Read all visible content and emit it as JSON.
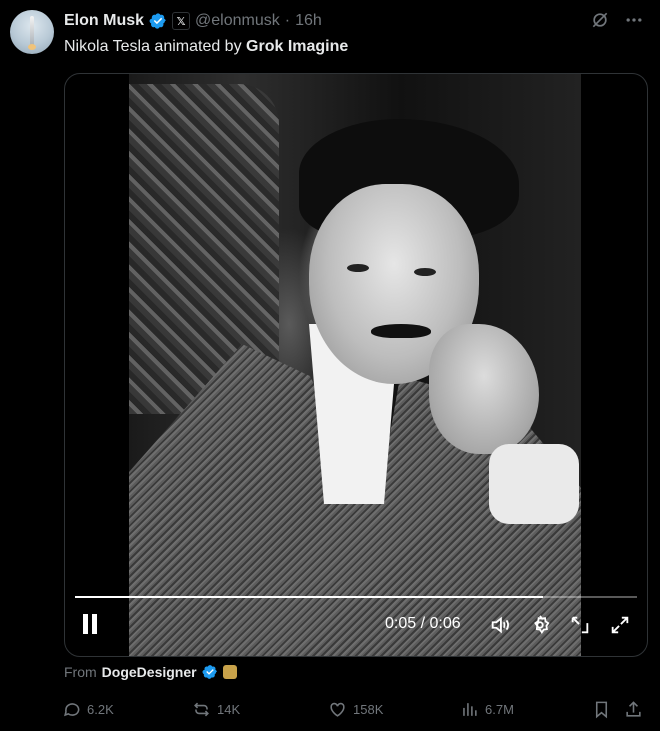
{
  "author": {
    "name": "Elon Musk",
    "handle": "@elonmusk",
    "time": "16h",
    "separator": "·",
    "affiliate_badge": "𝕏"
  },
  "post": {
    "text": "Nikola Tesla animated by ",
    "bold_text": "Grok Imagine"
  },
  "video": {
    "progress": 0.833,
    "time_display": "0:05 / 0:06",
    "state": "playing"
  },
  "from": {
    "label": "From",
    "source": "DogeDesigner"
  },
  "actions": {
    "replies": "6.2K",
    "reposts": "14K",
    "likes": "158K",
    "views": "6.7M"
  },
  "colors": {
    "background": "#000000",
    "text": "#e7e9ea",
    "muted": "#71767b",
    "verified": "#1d9bf0",
    "border": "#2f3336"
  },
  "icons": [
    "grok-icon",
    "more-icon",
    "pause-icon",
    "volume-icon",
    "settings-icon",
    "pip-icon",
    "fullscreen-icon",
    "reply-icon",
    "repost-icon",
    "like-icon",
    "views-icon",
    "bookmark-icon",
    "share-icon"
  ]
}
